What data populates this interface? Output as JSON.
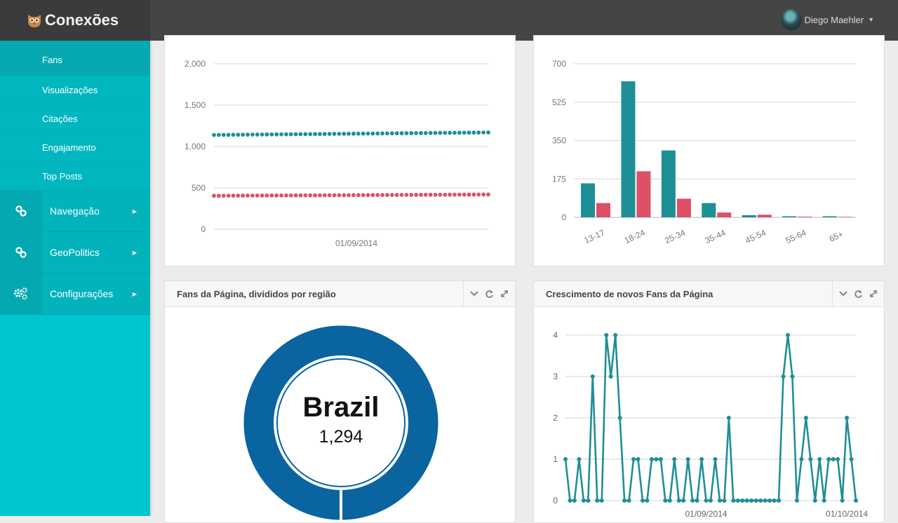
{
  "app": {
    "name": "Conexões"
  },
  "user": {
    "name": "Diego Maehler"
  },
  "sidebar": {
    "subitems": [
      {
        "label": "Fans"
      },
      {
        "label": "Visualizações"
      },
      {
        "label": "Citações"
      },
      {
        "label": "Engajamento"
      },
      {
        "label": "Top Posts"
      }
    ],
    "items": [
      {
        "label": "Navegação",
        "icon": "link-icon"
      },
      {
        "label": "GeoPolitics",
        "icon": "link-icon"
      },
      {
        "label": "Configurações",
        "icon": "gears-icon"
      }
    ]
  },
  "colors": {
    "teal": "#1e8f97",
    "red": "#dc5068",
    "blue": "#0964a0",
    "sidebar": "#00c7cf",
    "topbar": "#454545"
  },
  "panels": {
    "region": {
      "title": "Fans da Página, divididos por região",
      "center_label": "Brazil",
      "center_value": "1,294"
    },
    "growth": {
      "title": "Crescimento de novos Fans da Página"
    }
  },
  "chart_data": [
    {
      "type": "line",
      "ylim": [
        0,
        2000
      ],
      "yticks": [
        "0",
        "500",
        "1,000",
        "1,500",
        "2,000"
      ],
      "xlabel_tick": "01/09/2014",
      "series": [
        {
          "color": "#1e8f97",
          "start": 1140,
          "end": 1170,
          "points": 58
        },
        {
          "color": "#dc5068",
          "start": 405,
          "end": 420,
          "points": 58
        }
      ]
    },
    {
      "type": "bar",
      "categories": [
        "13-17",
        "18-24",
        "25-34",
        "35-44",
        "45-54",
        "55-64",
        "65+"
      ],
      "ylim": [
        0,
        700
      ],
      "yticks": [
        "0",
        "175",
        "350",
        "525",
        "700"
      ],
      "series": [
        {
          "color": "#1e8f97",
          "values": [
            155,
            620,
            305,
            65,
            10,
            5,
            5
          ]
        },
        {
          "color": "#dc5068",
          "values": [
            65,
            210,
            85,
            22,
            12,
            3,
            2
          ]
        }
      ]
    },
    {
      "type": "pie",
      "slices": [
        {
          "label": "Brazil",
          "value": 1294,
          "color": "#0964a0"
        }
      ]
    },
    {
      "type": "line",
      "ylim": [
        0,
        4
      ],
      "yticks": [
        "0",
        "1",
        "2",
        "3",
        "4"
      ],
      "xticks": [
        "01/09/2014",
        "01/10/2014"
      ],
      "series": [
        {
          "color": "#1e8f97",
          "values": [
            1,
            0,
            0,
            1,
            0,
            0,
            3,
            0,
            0,
            4,
            3,
            4,
            2,
            0,
            0,
            1,
            1,
            0,
            0,
            1,
            1,
            1,
            0,
            0,
            1,
            0,
            0,
            1,
            0,
            0,
            1,
            0,
            0,
            1,
            0,
            0,
            2,
            0,
            0,
            0,
            0,
            0,
            0,
            0,
            0,
            0,
            0,
            0,
            3,
            4,
            3,
            0,
            1,
            2,
            1,
            0,
            1,
            0,
            1,
            1,
            1,
            0,
            2,
            1,
            0
          ]
        }
      ]
    }
  ]
}
